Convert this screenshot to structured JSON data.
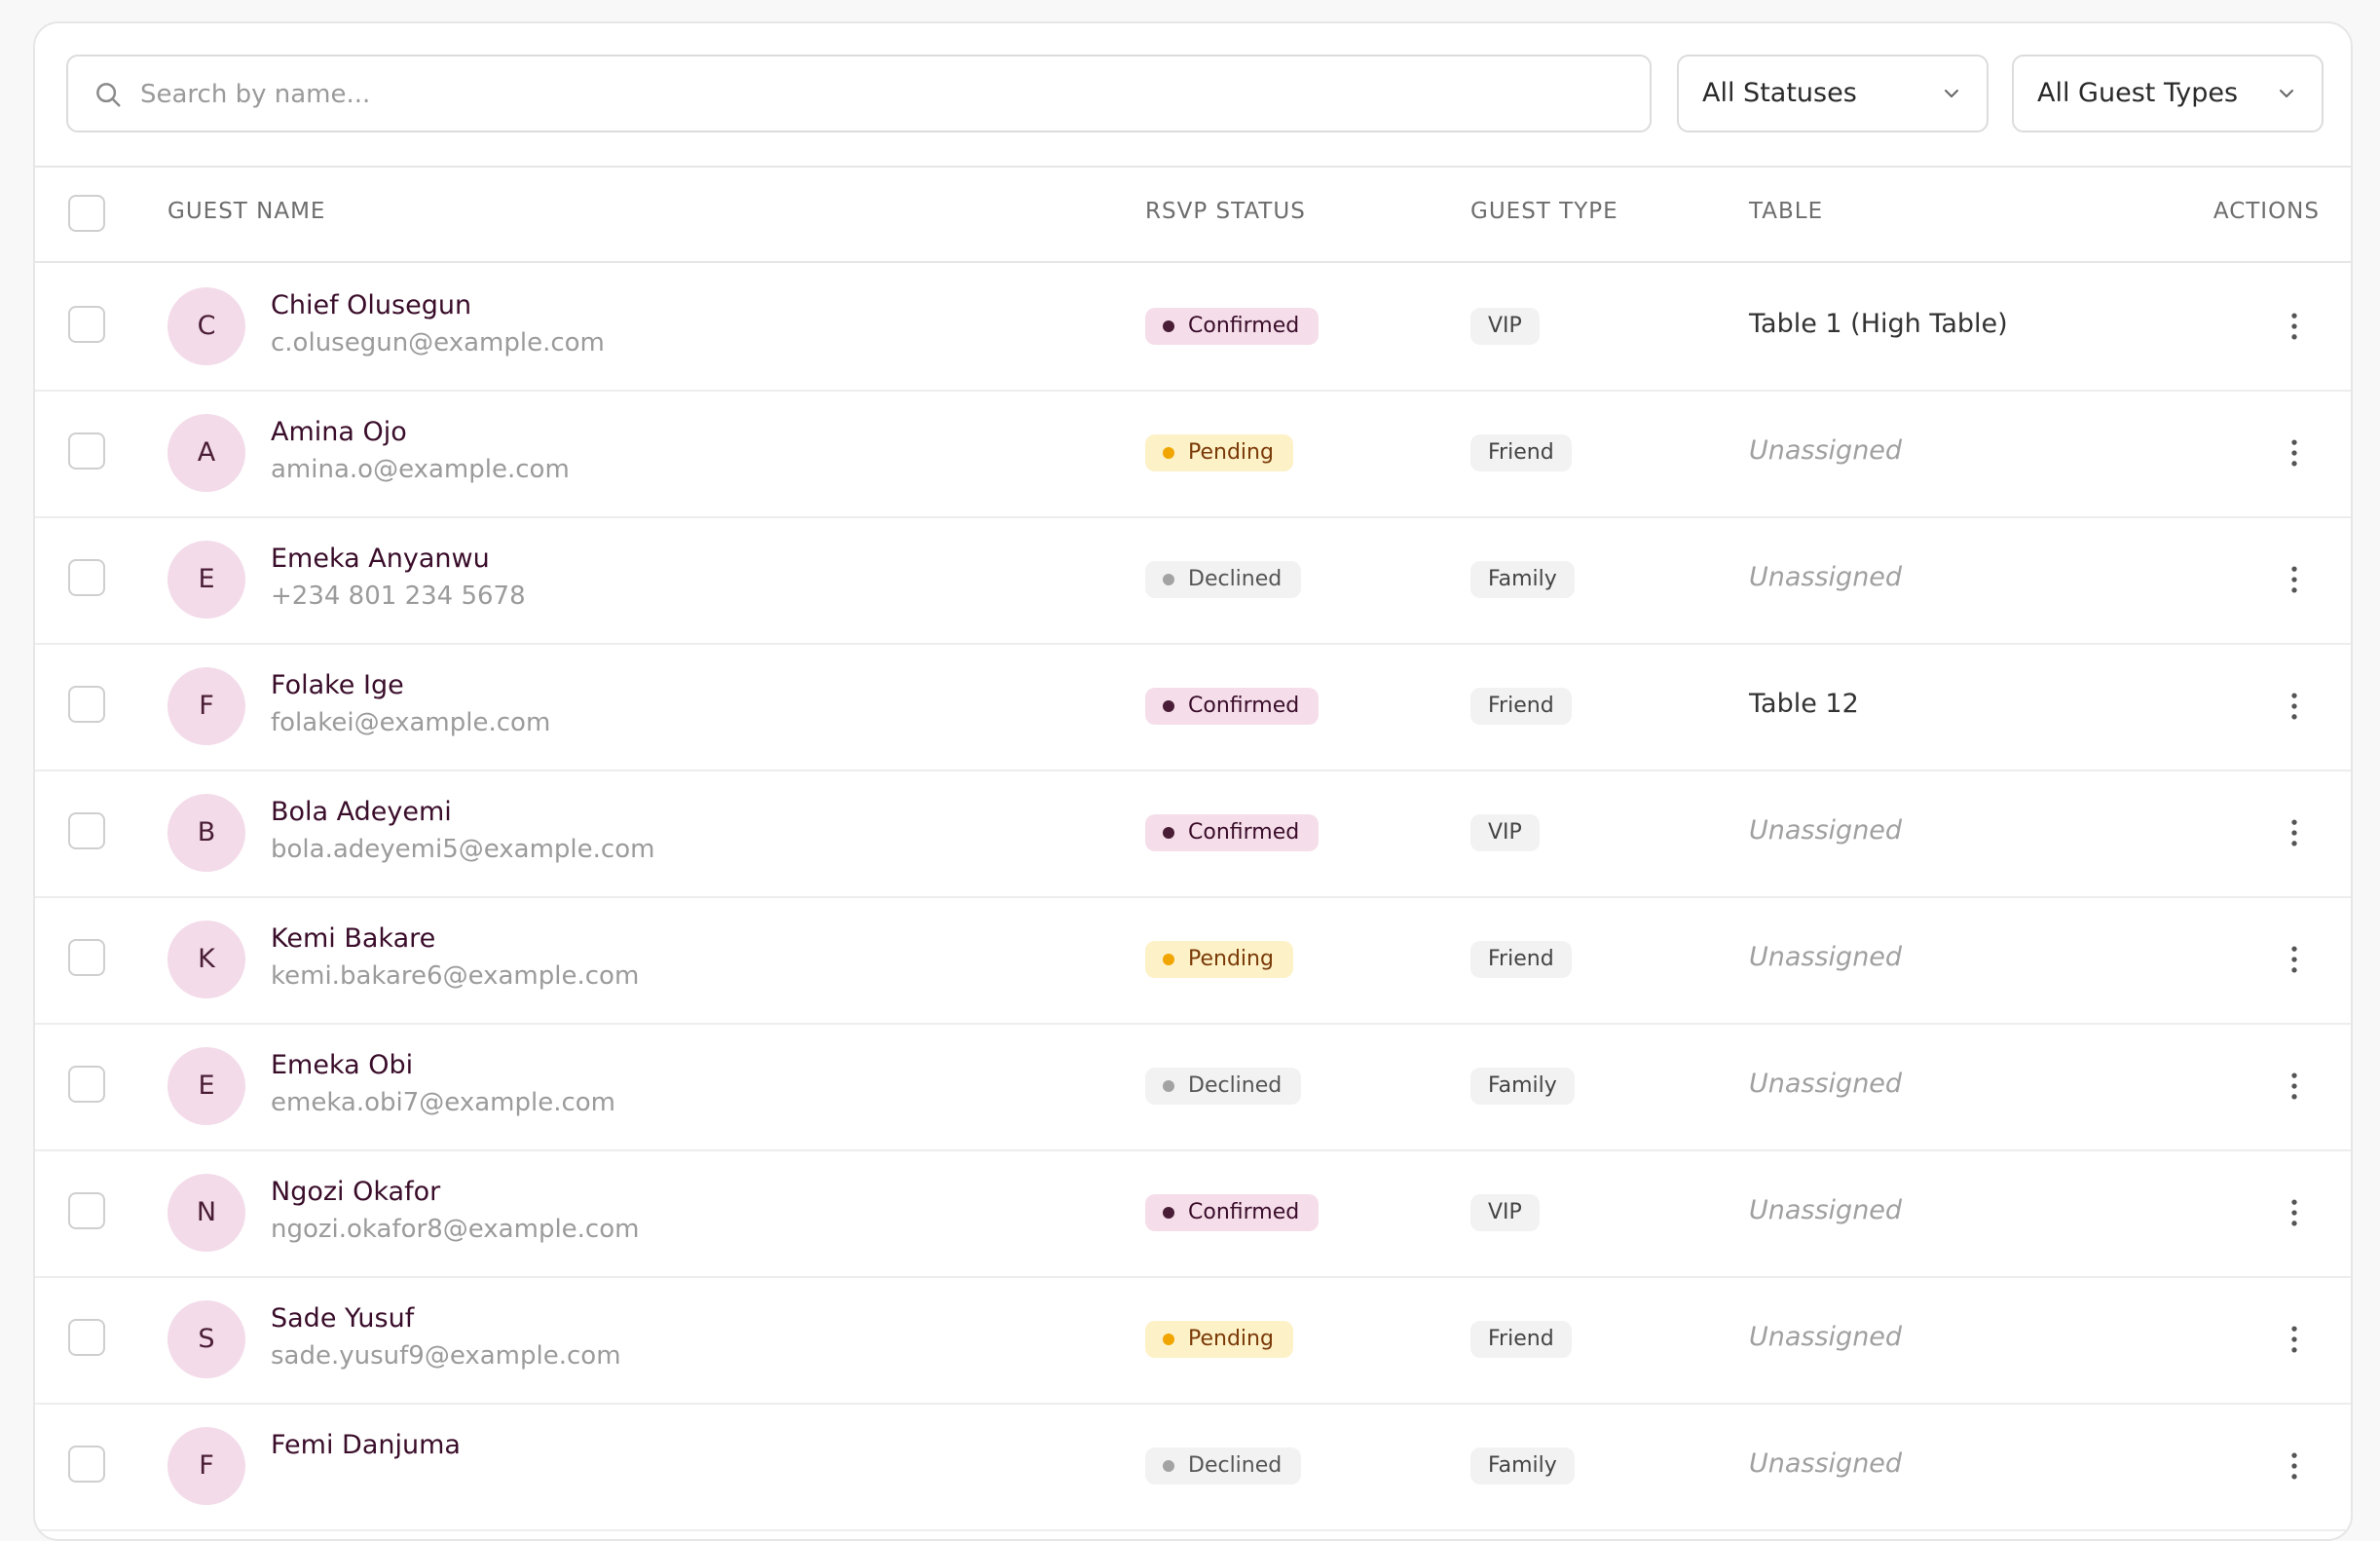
{
  "search": {
    "placeholder": "Search by name..."
  },
  "filters": {
    "status_label": "All Statuses",
    "type_label": "All Guest Types"
  },
  "columns": {
    "name": "GUEST NAME",
    "rsvp": "RSVP STATUS",
    "type": "GUEST TYPE",
    "table": "TABLE",
    "actions": "ACTIONS"
  },
  "guests": [
    {
      "initial": "C",
      "name": "Chief Olusegun",
      "contact": "c.olusegun@example.com",
      "status": "Confirmed",
      "type": "VIP",
      "table": "Table 1 (High Table)"
    },
    {
      "initial": "A",
      "name": "Amina Ojo",
      "contact": "amina.o@example.com",
      "status": "Pending",
      "type": "Friend",
      "table": "Unassigned"
    },
    {
      "initial": "E",
      "name": "Emeka Anyanwu",
      "contact": "+234 801 234 5678",
      "status": "Declined",
      "type": "Family",
      "table": "Unassigned"
    },
    {
      "initial": "F",
      "name": "Folake Ige",
      "contact": "folakei@example.com",
      "status": "Confirmed",
      "type": "Friend",
      "table": "Table 12"
    },
    {
      "initial": "B",
      "name": "Bola Adeyemi",
      "contact": "bola.adeyemi5@example.com",
      "status": "Confirmed",
      "type": "VIP",
      "table": "Unassigned"
    },
    {
      "initial": "K",
      "name": "Kemi Bakare",
      "contact": "kemi.bakare6@example.com",
      "status": "Pending",
      "type": "Friend",
      "table": "Unassigned"
    },
    {
      "initial": "E",
      "name": "Emeka Obi",
      "contact": "emeka.obi7@example.com",
      "status": "Declined",
      "type": "Family",
      "table": "Unassigned"
    },
    {
      "initial": "N",
      "name": "Ngozi Okafor",
      "contact": "ngozi.okafor8@example.com",
      "status": "Confirmed",
      "type": "VIP",
      "table": "Unassigned"
    },
    {
      "initial": "S",
      "name": "Sade Yusuf",
      "contact": "sade.yusuf9@example.com",
      "status": "Pending",
      "type": "Friend",
      "table": "Unassigned"
    },
    {
      "initial": "F",
      "name": "Femi Danjuma",
      "contact": "",
      "status": "Declined",
      "type": "Family",
      "table": "Unassigned"
    }
  ],
  "icons": {
    "search": "search-icon",
    "chevron": "chevron-down-icon",
    "actions": "more-vertical-icon"
  },
  "colors": {
    "accent": "#4a1d36",
    "avatar_bg": "#f3dbe9",
    "confirmed_bg": "#f5deea",
    "pending_bg": "#fdf1c7",
    "pending_dot": "#f0a500",
    "declined_bg": "#f2f2f2"
  }
}
